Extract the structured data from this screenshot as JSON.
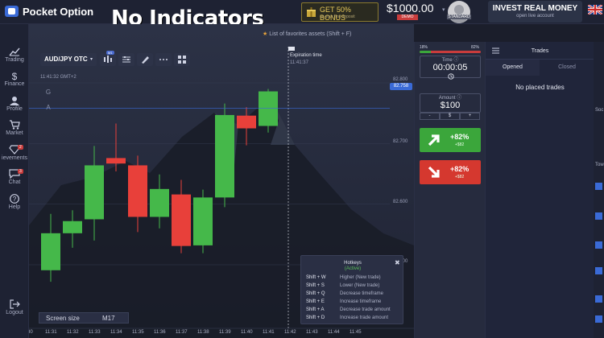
{
  "topbar": {
    "logo_text": "Pocket Option",
    "overlay_title": "No Indicators",
    "bonus_main": "GET 50% BONUS",
    "bonus_sub": "on your first deposit",
    "balance": "$1000.00",
    "demo_badge": "DEMO",
    "avatar_label": "STANDARD",
    "invest_main": "INVEST REAL MONEY",
    "invest_sub": "open live account"
  },
  "sidebar": {
    "items": [
      {
        "label": "Trading",
        "icon": "chart-icon"
      },
      {
        "label": "Finance",
        "icon": "dollar-icon"
      },
      {
        "label": "Profile",
        "icon": "user-icon"
      },
      {
        "label": "Market",
        "icon": "cart-icon"
      },
      {
        "label": "ievements",
        "icon": "diamond-icon",
        "badge": "2"
      },
      {
        "label": "Chat",
        "icon": "chat-icon",
        "badge": "3"
      },
      {
        "label": "Help",
        "icon": "help-icon"
      }
    ],
    "logout_label": "Logout"
  },
  "chart": {
    "favorites_hint": "List of favorites assets (Shift + F)",
    "asset": "AUD/JPY OTC",
    "timeframe_badge": "M1",
    "current_time": "11:41:32 GMT+2",
    "letters": [
      "G",
      "A"
    ],
    "expiration_label": "Expiration time",
    "expiration_time": "11:41:37",
    "price_current": "82.758",
    "price_labels": [
      "82.800",
      "82.700",
      "82.600",
      "82.500"
    ],
    "x_ticks": [
      "30",
      "11:31",
      "11:32",
      "11:33",
      "11:34",
      "11:35",
      "11:36",
      "11:37",
      "11:38",
      "11:39",
      "11:40",
      "11:41",
      "11:42",
      "11:43",
      "11:44",
      "11:45"
    ],
    "screen_size_label": "Screen size",
    "screen_size_value": "M17"
  },
  "candles": [
    {
      "time": "11:31",
      "open": 82.491,
      "close": 82.552,
      "high": 82.584,
      "low": 82.472
    },
    {
      "time": "11:32",
      "open": 82.552,
      "close": 82.572,
      "high": 82.59,
      "low": 82.528
    },
    {
      "time": "11:33",
      "open": 82.575,
      "close": 82.664,
      "high": 82.696,
      "low": 82.54
    },
    {
      "time": "11:34",
      "open": 82.676,
      "close": 82.667,
      "high": 82.733,
      "low": 82.654
    },
    {
      "time": "11:35",
      "open": 82.664,
      "close": 82.579,
      "high": 82.68,
      "low": 82.554
    },
    {
      "time": "11:36",
      "open": 82.579,
      "close": 82.625,
      "high": 82.649,
      "low": 82.56
    },
    {
      "time": "11:37",
      "open": 82.616,
      "close": 82.531,
      "high": 82.64,
      "low": 82.519
    },
    {
      "time": "11:38",
      "open": 82.532,
      "close": 82.611,
      "high": 82.624,
      "low": 82.519
    },
    {
      "time": "11:39",
      "open": 82.611,
      "close": 82.747,
      "high": 82.766,
      "low": 82.595
    },
    {
      "time": "11:40",
      "open": 82.746,
      "close": 82.725,
      "high": 82.76,
      "low": 82.697
    },
    {
      "time": "11:41",
      "open": 82.729,
      "close": 82.786,
      "high": 82.79,
      "low": 82.718
    }
  ],
  "colors": {
    "bull": "#45b84a",
    "bear": "#e8403a",
    "accent": "#3a6ad6",
    "bg": "#1b1e2b"
  },
  "hotkeys": {
    "title": "Hotkeys",
    "status": "(Active)",
    "rows": [
      {
        "key": "Shift + W",
        "action": "Higher (New trade)"
      },
      {
        "key": "Shift + S",
        "action": "Lower (New trade)"
      },
      {
        "key": "Shift + Q",
        "action": "Decrease timeframe"
      },
      {
        "key": "Shift + E",
        "action": "Increase timeframe"
      },
      {
        "key": "Shift + A",
        "action": "Decrease trade amount"
      },
      {
        "key": "Shift + D",
        "action": "Increase trade amount"
      }
    ]
  },
  "trade": {
    "sentiment_low": "18%",
    "sentiment_high": "82%",
    "sentiment_fraction": 0.18,
    "time_title": "Time",
    "time_value": "00:00:05",
    "amount_title": "Amount",
    "amount_value": "$100",
    "amount_minus": "-",
    "amount_currency": "$",
    "amount_plus": "+",
    "higher_pct": "+82%",
    "higher_abs": "+$82",
    "lower_pct": "+82%",
    "lower_abs": "+$82"
  },
  "trades": {
    "title": "Trades",
    "tab_opened": "Opened",
    "tab_closed": "Closed",
    "empty": "No placed trades"
  },
  "right_edge": {
    "labels": [
      "Soc",
      "Tow"
    ]
  }
}
